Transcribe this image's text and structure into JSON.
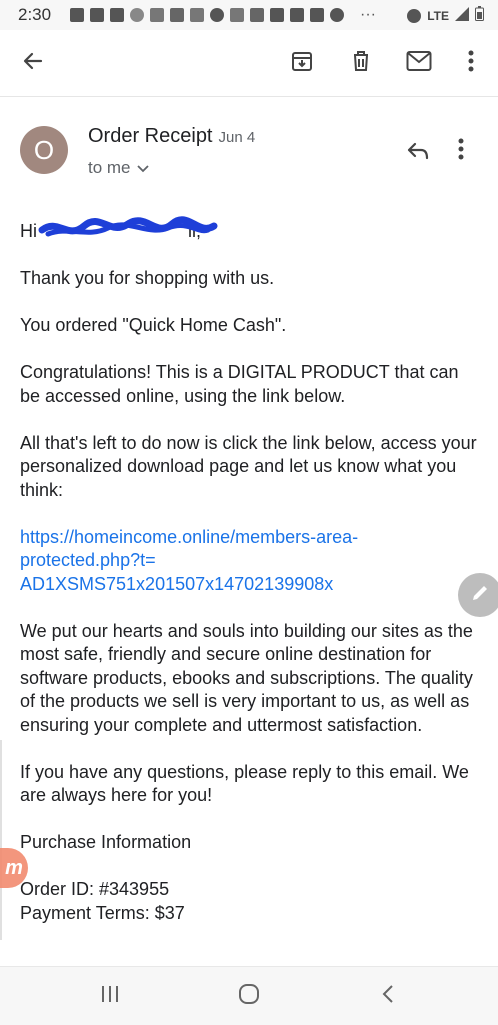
{
  "status_bar": {
    "time": "2:30",
    "more": "···",
    "network": "LTE",
    "icons": [
      "notification-icon",
      "facebook-icon",
      "facebook-icon",
      "bird-icon",
      "airplane-icon",
      "w-icon",
      "oyo-icon",
      "google-icon",
      "apps-icon",
      "w-icon",
      "mail-icon",
      "mail-icon",
      "mail-icon",
      "m-icon",
      "alarm-icon",
      "volte-icon",
      "signal-icon",
      "battery-icon"
    ]
  },
  "toolbar": {
    "back_icon": "arrow-left-icon",
    "archive_icon": "archive-icon",
    "delete_icon": "trash-icon",
    "mark_unread_icon": "mail-icon",
    "more_icon": "more-vert-icon"
  },
  "email": {
    "avatar_letter": "O",
    "subject": "Order Receipt",
    "date": "Jun 4",
    "to": "to me",
    "greeting_prefix": "Hi",
    "greeting_suffix": "ll,",
    "paragraphs": [
      "Thank you for shopping with us.",
      "You ordered \"Quick Home Cash\".",
      "Congratulations! This is a DIGITAL PRODUCT that can be accessed online, using the link below.",
      "All that's left to do now is click the link below, access your personalized download page and let us know what you think:"
    ],
    "link": "https://homeincome.online/members-area-protected.php?t=AD1XSMS751x201507x14702139908x",
    "link_lines": [
      "https://homeincome.online/members-area-",
      "protected.php?t=",
      "AD1XSMS751x201507x14702139908x"
    ],
    "paragraphs_after": [
      "We put our hearts and souls into building our sites as the most safe, friendly and secure online destination for software products, ebooks and subscriptions. The quality of the products we sell is very important to us, as well as ensuring your complete and uttermost satisfaction.",
      "If you have any questions, please reply to this email. We are always here for you!"
    ],
    "purchase_heading": "Purchase Information",
    "order_id": "Order ID: #343955",
    "payment_terms": "Payment Terms: $37"
  },
  "side_tab": {
    "letter": "m"
  },
  "colors": {
    "link": "#1a73e8",
    "avatar": "#a1887f",
    "scribble": "#1e3fd8",
    "side_tab": "#f28b6f"
  }
}
